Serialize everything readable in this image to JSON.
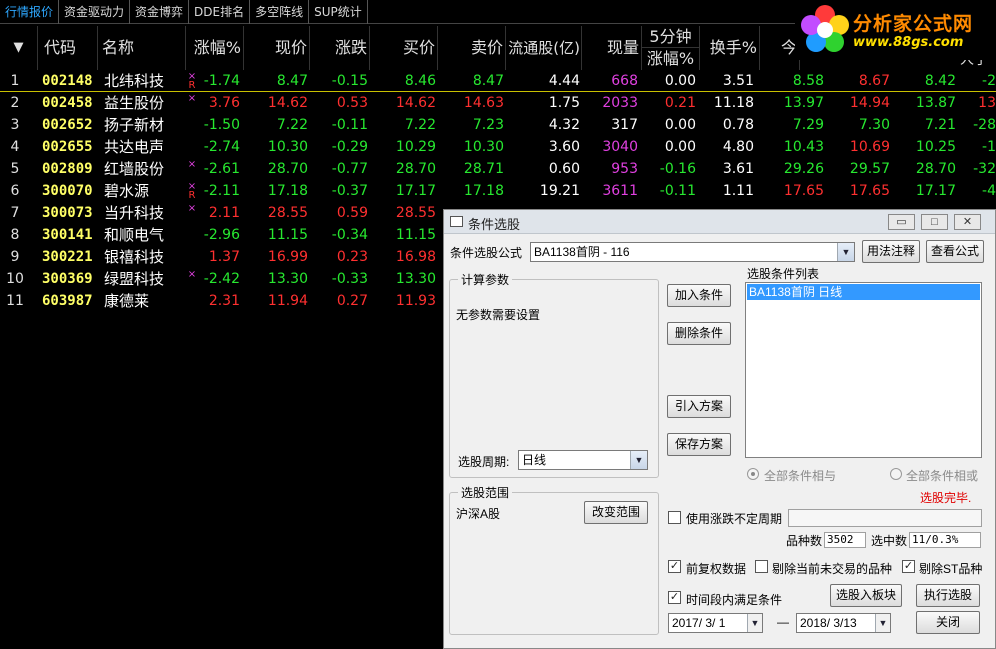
{
  "tabs": [
    "行情报价",
    "资金驱动力",
    "资金博弈",
    "DDE排名",
    "多空阵线",
    "SUP统计"
  ],
  "logo": {
    "brand": "分析家公式网",
    "site": "www.88gs.com"
  },
  "columns": {
    "menu": "▼",
    "code": "代码",
    "name": "名称",
    "change_pct": "涨幅%",
    "price": "现价",
    "change": "涨跌",
    "bid": "买价",
    "ask": "卖价",
    "float_shares": "流通股(亿)",
    "volume": "现量",
    "five_min_top": "5分钟",
    "five_min_bottom": "涨幅%",
    "turnover": "换手%",
    "open": "今",
    "extra": "人于"
  },
  "rows": [
    {
      "idx": "1",
      "code": "002148",
      "name": "北纬科技",
      "mark_top": "×",
      "mark_bottom": "R",
      "change_pct": "-1.74",
      "price": "8.47",
      "change": "-0.15",
      "bid": "8.46",
      "ask": "8.47",
      "float_shares": "4.44",
      "volume": "668",
      "five_min": "0.00",
      "turnover": "3.51",
      "open": "8.58",
      "high": "8.67",
      "low": "8.42",
      "extra": "-2"
    },
    {
      "idx": "2",
      "code": "002458",
      "name": "益生股份",
      "mark_top": "×",
      "mark_bottom": "",
      "change_pct": "3.76",
      "price": "14.62",
      "change": "0.53",
      "bid": "14.62",
      "ask": "14.63",
      "float_shares": "1.75",
      "volume": "2033",
      "five_min": "0.21",
      "turnover": "11.18",
      "open": "13.97",
      "high": "14.94",
      "low": "13.87",
      "extra": "13"
    },
    {
      "idx": "3",
      "code": "002652",
      "name": "扬子新材",
      "mark_top": "",
      "mark_bottom": "",
      "change_pct": "-1.50",
      "price": "7.22",
      "change": "-0.11",
      "bid": "7.22",
      "ask": "7.23",
      "float_shares": "4.32",
      "volume": "317",
      "five_min": "0.00",
      "turnover": "0.78",
      "open": "7.29",
      "high": "7.30",
      "low": "7.21",
      "extra": "-28"
    },
    {
      "idx": "4",
      "code": "002655",
      "name": "共达电声",
      "mark_top": "",
      "mark_bottom": "",
      "change_pct": "-2.74",
      "price": "10.30",
      "change": "-0.29",
      "bid": "10.29",
      "ask": "10.30",
      "float_shares": "3.60",
      "volume": "3040",
      "five_min": "0.00",
      "turnover": "4.80",
      "open": "10.43",
      "high": "10.69",
      "low": "10.25",
      "extra": "-1"
    },
    {
      "idx": "5",
      "code": "002809",
      "name": "红墙股份",
      "mark_top": "×",
      "mark_bottom": "",
      "change_pct": "-2.61",
      "price": "28.70",
      "change": "-0.77",
      "bid": "28.70",
      "ask": "28.71",
      "float_shares": "0.60",
      "volume": "953",
      "five_min": "-0.16",
      "turnover": "3.61",
      "open": "29.26",
      "high": "29.57",
      "low": "28.70",
      "extra": "-32"
    },
    {
      "idx": "6",
      "code": "300070",
      "name": "碧水源",
      "mark_top": "×",
      "mark_bottom": "R",
      "change_pct": "-2.11",
      "price": "17.18",
      "change": "-0.37",
      "bid": "17.17",
      "ask": "17.18",
      "float_shares": "19.21",
      "volume": "3611",
      "five_min": "-0.11",
      "turnover": "1.11",
      "open": "17.65",
      "high": "17.65",
      "low": "17.17",
      "extra": "-4"
    },
    {
      "idx": "7",
      "code": "300073",
      "name": "当升科技",
      "mark_top": "×",
      "mark_bottom": "",
      "change_pct": "2.11",
      "price": "28.55",
      "change": "0.59",
      "bid": "28.55"
    },
    {
      "idx": "8",
      "code": "300141",
      "name": "和顺电气",
      "mark_top": "",
      "mark_bottom": "",
      "change_pct": "-2.96",
      "price": "11.15",
      "change": "-0.34",
      "bid": "11.15"
    },
    {
      "idx": "9",
      "code": "300221",
      "name": "银禧科技",
      "mark_top": "",
      "mark_bottom": "",
      "change_pct": "1.37",
      "price": "16.99",
      "change": "0.23",
      "bid": "16.98"
    },
    {
      "idx": "10",
      "code": "300369",
      "name": "绿盟科技",
      "mark_top": "×",
      "mark_bottom": "",
      "change_pct": "-2.42",
      "price": "13.30",
      "change": "-0.33",
      "bid": "13.30"
    },
    {
      "idx": "11",
      "code": "603987",
      "name": "康德莱",
      "mark_top": "",
      "mark_bottom": "",
      "change_pct": "2.31",
      "price": "11.94",
      "change": "0.27",
      "bid": "11.93"
    }
  ],
  "dialog": {
    "title": "条件选股",
    "formula_label": "条件选股公式",
    "formula_value": "BA1138首阴  - 116",
    "usage_btn": "用法注释",
    "view_btn": "查看公式",
    "calc_group": "计算参数",
    "no_params": "无参数需要设置",
    "period_label": "选股周期:",
    "period_value": "日线",
    "add_btn": "加入条件",
    "delete_btn": "删除条件",
    "import_btn": "引入方案",
    "save_btn": "保存方案",
    "cond_list_label": "选股条件列表",
    "cond_items": [
      "BA1138首阴  日线"
    ],
    "radio_and": "全部条件相与",
    "radio_or": "全部条件相或",
    "status": "选股完毕.",
    "scope_group": "选股范围",
    "scope_value": "沪深A股",
    "change_scope_btn": "改变范围",
    "uncertain_period": "使用涨跌不定周期",
    "count_label": "品种数",
    "count_value": "3502",
    "selected_label": "选中数",
    "selected_value": "11/0.3%",
    "adj_data": "前复权数据",
    "exclude_non_trading": "剔除当前未交易的品种",
    "exclude_st": "剔除ST品种",
    "time_range": "时间段内满足条件",
    "to_block_btn": "选股入板块",
    "execute_btn": "执行选股",
    "date_from": "2017/ 3/ 1",
    "date_sep": "—",
    "date_to": "2018/ 3/13",
    "close_btn": "关闭"
  },
  "colors": {
    "up": "#ff3030",
    "down": "#27e830",
    "code": "#ffff66",
    "tab_active": "#2ea8ff",
    "selection": "#3399ff"
  }
}
